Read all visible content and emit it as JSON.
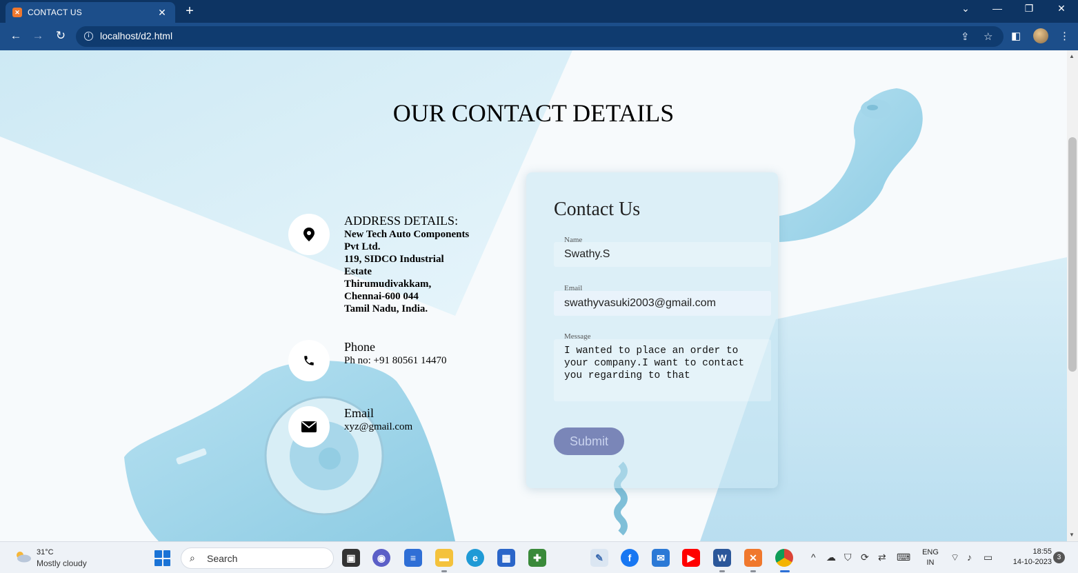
{
  "browser": {
    "tab_title": "CONTACT US",
    "tab_close": "✕",
    "new_tab": "+",
    "url": "localhost/d2.html",
    "controls": {
      "dropdown": "⌄",
      "minimize": "—",
      "restore": "❐",
      "close": "✕"
    }
  },
  "page": {
    "heading": "OUR CONTACT DETAILS",
    "address": {
      "title": "ADDRESS DETAILS:",
      "lines": [
        "New Tech Auto Components",
        "Pvt Ltd.",
        "119, SIDCO Industrial",
        "Estate",
        "Thirumudivakkam,",
        "Chennai-600 044",
        "Tamil Nadu, India."
      ]
    },
    "phone": {
      "title": "Phone",
      "value": "Ph no: +91 80561 14470"
    },
    "email": {
      "title": "Email",
      "value": "xyz@gmail.com"
    },
    "form": {
      "title": "Contact Us",
      "name_label": "Name",
      "name_value": "Swathy.S",
      "email_label": "Email",
      "email_value": "swathyvasuki2003@gmail.com",
      "message_label": "Message",
      "message_value": "I wanted to place an order to\nyour company.I want to contact\nyou regarding to that",
      "submit_label": "Submit"
    }
  },
  "taskbar": {
    "weather_temp": "31°C",
    "weather_desc": "Mostly cloudy",
    "search_placeholder": "Search",
    "lang_top": "ENG",
    "lang_bottom": "IN",
    "time": "18:55",
    "date": "14-10-2023",
    "notifications": "3"
  },
  "colors": {
    "chrome_dark": "#0d3463",
    "chrome_toolbar": "#1c4e8a",
    "phone_blue": "#9fd6ea",
    "submit_bg": "#7a86b8"
  }
}
